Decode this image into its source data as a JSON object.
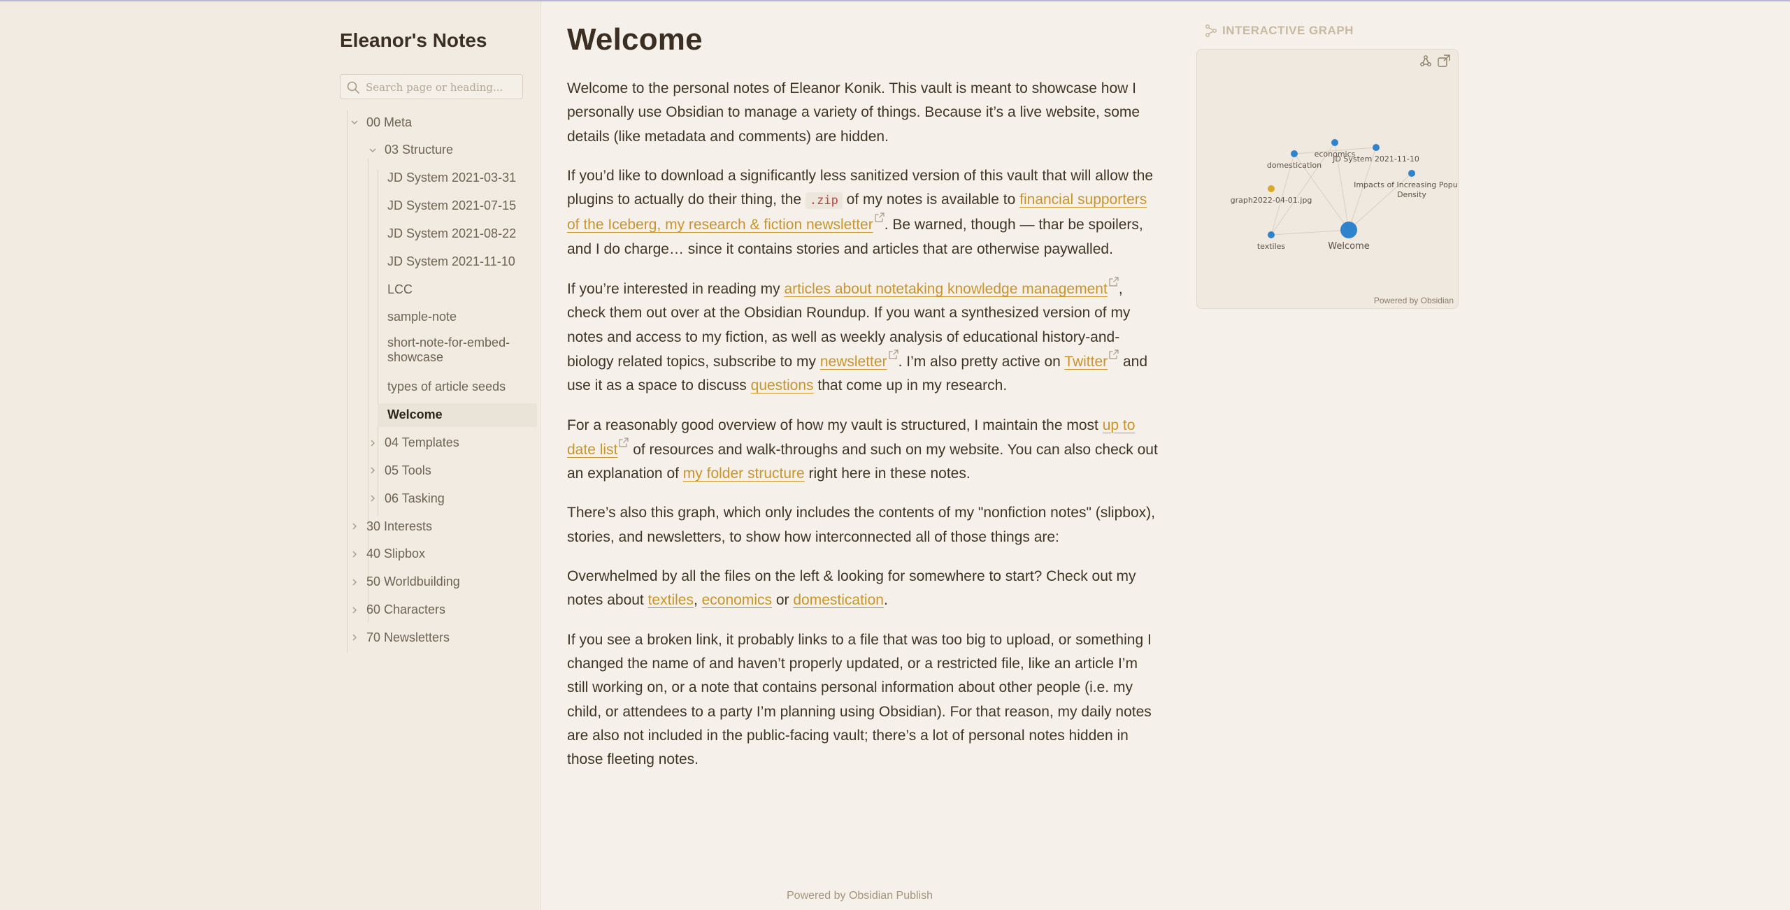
{
  "site": {
    "title": "Eleanor's Notes",
    "search_placeholder": "Search page or heading..."
  },
  "tree": [
    {
      "label": "00 Meta",
      "level": 0,
      "state": "expanded"
    },
    {
      "label": "03 Structure",
      "level": 1,
      "state": "expanded"
    },
    {
      "label": "JD System 2021-03-31",
      "level": 2,
      "state": "leaf"
    },
    {
      "label": "JD System 2021-07-15",
      "level": 2,
      "state": "leaf"
    },
    {
      "label": "JD System 2021-08-22",
      "level": 2,
      "state": "leaf"
    },
    {
      "label": "JD System 2021-11-10",
      "level": 2,
      "state": "leaf"
    },
    {
      "label": "LCC",
      "level": 2,
      "state": "leaf"
    },
    {
      "label": "sample-note",
      "level": 2,
      "state": "leaf"
    },
    {
      "label": "short-note-for-embed-showcase",
      "level": 2,
      "state": "leaf"
    },
    {
      "label": "types of article seeds",
      "level": 2,
      "state": "leaf"
    },
    {
      "label": "Welcome",
      "level": 2,
      "state": "active"
    },
    {
      "label": "04 Templates",
      "level": 1,
      "state": "collapsed"
    },
    {
      "label": "05 Tools",
      "level": 1,
      "state": "collapsed"
    },
    {
      "label": "06 Tasking",
      "level": 1,
      "state": "collapsed"
    },
    {
      "label": "30 Interests",
      "level": 0,
      "state": "collapsed"
    },
    {
      "label": "40 Slipbox",
      "level": 0,
      "state": "collapsed"
    },
    {
      "label": "50 Worldbuilding",
      "level": 0,
      "state": "collapsed"
    },
    {
      "label": "60 Characters",
      "level": 0,
      "state": "collapsed"
    },
    {
      "label": "70 Newsletters",
      "level": 0,
      "state": "collapsed"
    }
  ],
  "page": {
    "title": "Welcome",
    "p1": "Welcome to the personal notes of Eleanor Konik. This vault is meant to showcase how I personally use Obsidian to manage a variety of things. Because it’s a live website, some details (like metadata and comments) are hidden.",
    "p2": {
      "t1": "If you’d like to download a significantly less sanitized version of this vault that will allow the plugins to actually do their thing, the ",
      "code": ".zip",
      "t2": " of my notes is available to ",
      "link": "financial supporters of the Iceberg, my research & fiction newsletter",
      "t3": ". Be warned, though — thar be spoilers, and I do charge… since it contains stories and articles that are otherwise paywalled."
    },
    "p3": {
      "t1": "If you’re interested in reading my ",
      "link1": "articles about notetaking knowledge management",
      "t2": ", check them out over at the Obsidian Roundup. If you want a synthesized version of my notes and access to my fiction, as well as weekly analysis of educational history-and-biology related topics, subscribe to my ",
      "link2": "newsletter",
      "t3": ". I’m also pretty active on ",
      "link3": "Twitter",
      "t4": " and use it as a space to discuss ",
      "link4": "questions",
      "t5": " that come up in my research."
    },
    "p4": {
      "t1": "For a reasonably good overview of how my vault is structured, I maintain the most ",
      "link1": "up to date list",
      "t2": " of resources and walk-throughs and such on my website. You can also check out an explanation of ",
      "link2": "my folder structure",
      "t3": " right here in these notes."
    },
    "p5": "There’s also this graph, which only includes the contents of my \"nonfiction notes\" (slipbox), stories, and newsletters, to show how interconnected all of those things are:",
    "p6": {
      "t1": "Overwhelmed by all the files on the left & looking for somewhere to start? Check out my notes about ",
      "link1": "textiles",
      "t2": ", ",
      "link2": "economics",
      "t3": " or ",
      "link3": "domestication",
      "t4": "."
    },
    "p7": "If you see a broken link, it probably links to a file that was too big to upload, or something I changed the name of and haven’t properly updated, or a restricted file, like an article I’m still working on, or a note that contains personal information about other people (i.e. my child, or attendees to a party I’m planning using Obsidian). For that reason, my daily notes are also not included in the public-facing vault; there’s a lot of personal notes hidden in those fleeting notes.",
    "footer": "Powered by Obsidian Publish"
  },
  "graph": {
    "header": "INTERACTIVE GRAPH",
    "powered": "Powered by Obsidian",
    "nodes": {
      "welcome": "Welcome",
      "domestication": "domestication",
      "economics": "economics",
      "jd": "JD System 2021-11-10",
      "impacts_1": "Impacts of Increasing Popul",
      "impacts_2": "Density",
      "image": "graph2022-04-01.jpg",
      "textiles": "textiles"
    }
  },
  "colors": {
    "accent": "#c8952b",
    "node_blue": "#2f82cc",
    "node_gold": "#d9a92a"
  }
}
